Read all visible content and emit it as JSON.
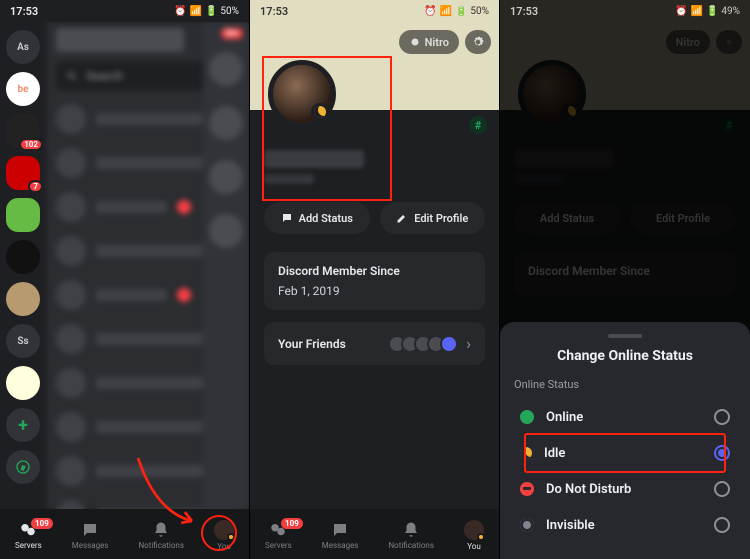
{
  "status_bar": {
    "time": "17:53",
    "battery_p1": "50%",
    "battery_p2": "50%",
    "battery_p3": "49%"
  },
  "pane1": {
    "search_placeholder": "Search",
    "sidebar": {
      "dm_label": "As",
      "initials_label": "Ss",
      "server_badges": {
        "srv1": "102",
        "srv2": "7"
      }
    },
    "notif_pill": "99+"
  },
  "pane2": {
    "nitro_label": "Nitro",
    "add_status_label": "Add Status",
    "edit_profile_label": "Edit Profile",
    "member_since_label": "Discord Member Since",
    "member_since_value": "Feb 1, 2019",
    "friends_label": "Your Friends"
  },
  "pane3": {
    "nitro_label": "Nitro",
    "sheet_title": "Change Online Status",
    "section_label": "Online Status",
    "options": {
      "online": "Online",
      "idle": "Idle",
      "dnd": "Do Not Disturb",
      "invisible": "Invisible"
    },
    "member_since_label": "Discord Member Since"
  },
  "bottom_nav": {
    "servers": "Servers",
    "messages": "Messages",
    "notifications": "Notifications",
    "you": "You",
    "badge": "109"
  }
}
